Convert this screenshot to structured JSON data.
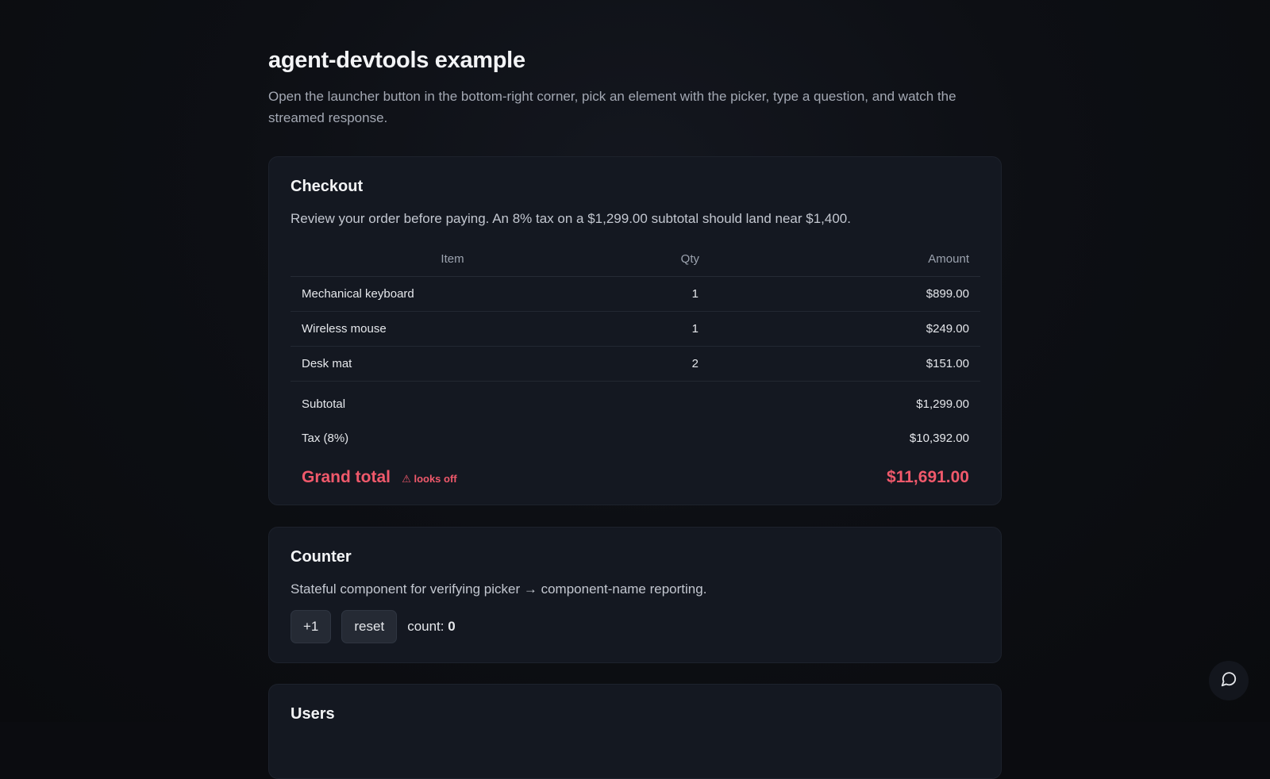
{
  "header": {
    "title": "agent-devtools example",
    "intro": "Open the launcher button in the bottom-right corner, pick an element with the picker, type a question, and watch the streamed response."
  },
  "checkout": {
    "title": "Checkout",
    "description": "Review your order before paying. An 8% tax on a $1,299.00 subtotal should land near $1,400.",
    "columns": {
      "item": "Item",
      "qty": "Qty",
      "amount": "Amount"
    },
    "rows": [
      {
        "item": "Mechanical keyboard",
        "qty": "1",
        "amount": "$899.00"
      },
      {
        "item": "Wireless mouse",
        "qty": "1",
        "amount": "$249.00"
      },
      {
        "item": "Desk mat",
        "qty": "2",
        "amount": "$151.00"
      }
    ],
    "subtotal_label": "Subtotal",
    "subtotal_value": "$1,299.00",
    "tax_label": "Tax (8%)",
    "tax_value": "$10,392.00",
    "grand_label": "Grand total",
    "warning": "⚠ looks off",
    "grand_value": "$11,691.00",
    "error_color": "#f0596b"
  },
  "counter": {
    "title": "Counter",
    "description": "Stateful component for verifying picker → component-name reporting.",
    "increment_label": "+1",
    "reset_label": "reset",
    "count_label": "count:",
    "count_value": "0"
  },
  "users": {
    "title": "Users"
  },
  "launcher": {
    "icon": "chat-bubble-icon"
  }
}
